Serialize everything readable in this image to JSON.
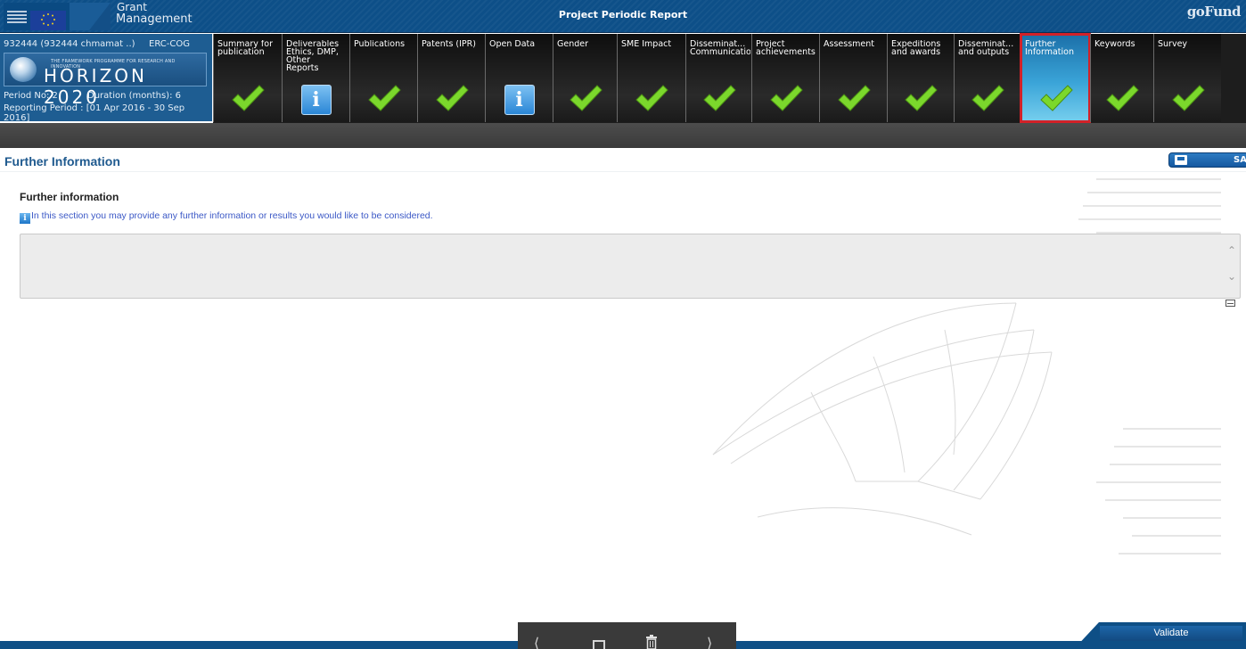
{
  "header": {
    "logo_title_line1": "Grant",
    "logo_title_line2": "Management",
    "report_title": "Project Periodic Report",
    "brand": "goFund"
  },
  "project": {
    "id_text": "932444 (932444 chmamat ..)",
    "type": "ERC-COG",
    "programme_small": "THE FRAMEWORK PROGRAMME FOR RESEARCH AND INNOVATION",
    "programme_big": "HORIZON 2020",
    "period": "Period No: 2",
    "duration": "Duration (months): 6",
    "reporting": "Reporting Period : [01 Apr 2016 - 30 Sep 2016]"
  },
  "tabs": [
    {
      "label": "Summary for\npublication",
      "icon": "check-icon"
    },
    {
      "label": "Deliverables\nEthics, DMP,\nOther\nReports",
      "icon": "info-icon"
    },
    {
      "label": "Publications",
      "icon": "check-icon"
    },
    {
      "label": "Patents (IPR)",
      "icon": "check-icon"
    },
    {
      "label": "Open Data",
      "icon": "info-icon"
    },
    {
      "label": "Gender",
      "icon": "check-icon"
    },
    {
      "label": "SME Impact",
      "icon": "check-icon"
    },
    {
      "label": "Disseminat...\nCommunicatio",
      "icon": "check-icon"
    },
    {
      "label": "Project\nachievements",
      "icon": "check-icon"
    },
    {
      "label": "Assessment",
      "icon": "check-icon"
    },
    {
      "label": "Expeditions\nand awards",
      "icon": "check-icon"
    },
    {
      "label": "Disseminat...\nand outputs",
      "icon": "check-icon"
    },
    {
      "label": "Further\nInformation",
      "icon": "check-icon",
      "active": true
    },
    {
      "label": "Keywords",
      "icon": "check-icon"
    },
    {
      "label": "Survey",
      "icon": "check-icon"
    }
  ],
  "section": {
    "title": "Further Information",
    "save_label": "SAV",
    "field_label": "Further information",
    "hint": "In this section you may provide any further information or results you would like to be considered.",
    "textarea_value": ""
  },
  "footer": {
    "validate_label": "Validate"
  },
  "colors": {
    "header_blue": "#0d4f88",
    "active_tab_border": "#d22128",
    "check_green": "#7bd82c",
    "section_title": "#1f5a8f"
  }
}
